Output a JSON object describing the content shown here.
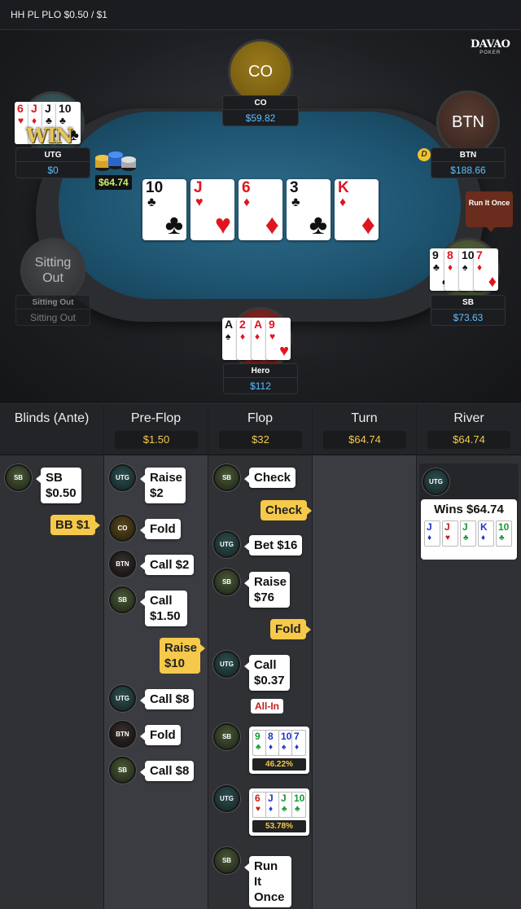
{
  "header": {
    "title": "HH PL PLO $0.50 / $1"
  },
  "brand": {
    "line1": "DAVAO",
    "line2": "POKER"
  },
  "seats": {
    "co": {
      "disc": "CO",
      "name": "CO",
      "stack": "$59.82"
    },
    "btn": {
      "disc": "BTN",
      "name": "BTN",
      "stack": "$188.66"
    },
    "utg": {
      "name": "UTG",
      "stack": "$0",
      "win": "WIN"
    },
    "sb": {
      "name": "SB",
      "stack": "$73.63"
    },
    "hero": {
      "name": "Hero",
      "stack": "$112"
    },
    "sitout": {
      "disc": "Sitting Out",
      "name": "Sitting Out",
      "stack": "Sitting Out"
    }
  },
  "dealer_button": "D",
  "pot_on_table": "$64.74",
  "run_it_once": "Run It Once",
  "board": [
    {
      "rank": "10",
      "suit": "♣",
      "color": "#111111"
    },
    {
      "rank": "J",
      "suit": "♥",
      "color": "#e0161f"
    },
    {
      "rank": "6",
      "suit": "♦",
      "color": "#e0161f"
    },
    {
      "rank": "3",
      "suit": "♣",
      "color": "#111111"
    },
    {
      "rank": "K",
      "suit": "♦",
      "color": "#e0161f"
    }
  ],
  "utg_cards": [
    {
      "rank": "6",
      "suit": "♥"
    },
    {
      "rank": "J",
      "suit": "♦"
    },
    {
      "rank": "J",
      "suit": "♣"
    },
    {
      "rank": "10",
      "suit": "♣"
    }
  ],
  "sb_cards": [
    {
      "rank": "9",
      "suit": "♣"
    },
    {
      "rank": "8",
      "suit": "♦"
    },
    {
      "rank": "10",
      "suit": "♠"
    },
    {
      "rank": "7",
      "suit": "♦"
    }
  ],
  "hero_cards": [
    {
      "rank": "A",
      "suit": "♠"
    },
    {
      "rank": "2",
      "suit": "♦"
    },
    {
      "rank": "A",
      "suit": "♦"
    },
    {
      "rank": "9",
      "suit": "♥"
    }
  ],
  "history": {
    "columns": [
      {
        "name": "Blinds (Ante)",
        "pot": ""
      },
      {
        "name": "Pre-Flop",
        "pot": "$1.50"
      },
      {
        "name": "Flop",
        "pot": "$32"
      },
      {
        "name": "Turn",
        "pot": "$64.74"
      },
      {
        "name": "River",
        "pot": "$64.74"
      }
    ],
    "blinds": {
      "sb_chip": "SB",
      "sb_action": "SB\n$0.50",
      "bb_action": "BB $1"
    },
    "preflop": [
      {
        "chip": "UTG",
        "text": "Raise $2"
      },
      {
        "chip": "CO",
        "text": "Fold"
      },
      {
        "chip": "BTN",
        "text": "Call $2"
      },
      {
        "chip": "SB",
        "text": "Call $1.50"
      },
      {
        "hero_text": "Raise $10"
      },
      {
        "chip": "UTG",
        "text": "Call $8"
      },
      {
        "chip": "BTN",
        "text": "Fold"
      },
      {
        "chip": "SB",
        "text": "Call $8"
      }
    ],
    "flop": {
      "sb_check": "Check",
      "hero_check": "Check",
      "utg_bet": "Bet $16",
      "sb_raise": "Raise $76",
      "hero_fold": "Fold",
      "utg_call": "Call $0.37",
      "allin": "All-In",
      "sb_equity": "46.22%",
      "utg_equity": "53.78%",
      "runit": "Run It Once",
      "chips": [
        "SB",
        "UTG",
        "SB",
        "UTG",
        "SB",
        "UTG",
        "SB"
      ]
    },
    "river": {
      "chip": "UTG",
      "wins": "Wins $64.74"
    }
  }
}
